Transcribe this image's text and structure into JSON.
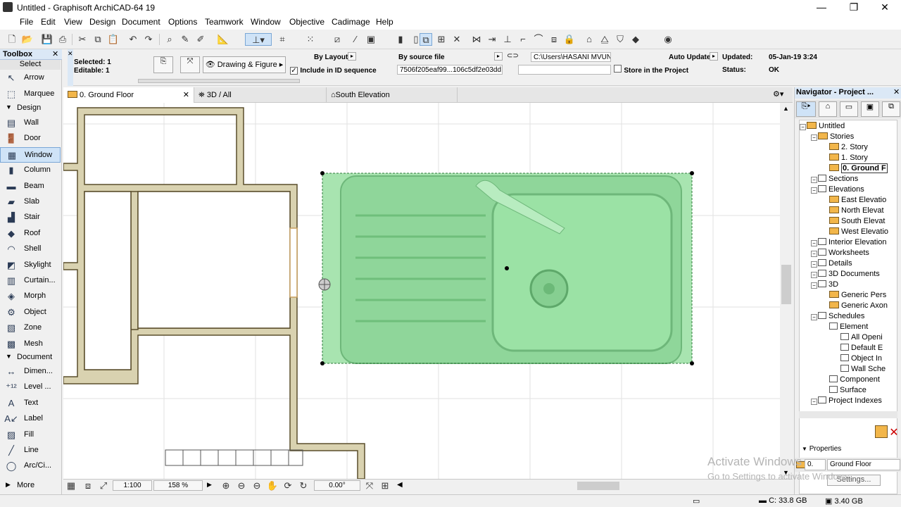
{
  "window": {
    "title": "Untitled - Graphisoft ArchiCAD-64 19",
    "minimize": "—",
    "restore": "❐",
    "close": "✕"
  },
  "menu": [
    "File",
    "Edit",
    "View",
    "Design",
    "Document",
    "Options",
    "Teamwork",
    "Window",
    "Objective",
    "Cadimage",
    "Help"
  ],
  "infobox": {
    "selected": "Selected: 1",
    "editable": "Editable: 1",
    "drawing_figure": "Drawing & Figure",
    "by_layout": "By Layout",
    "include_id": "Include in ID sequence",
    "by_source": "By source file",
    "file_id": "7506f205eaf99...106c5df2e03dd",
    "path": "C:\\Users\\HASANI MVUN",
    "auto_update": "Auto Update",
    "store_project": "Store in the Project",
    "updated_label": "Updated:",
    "updated_value": "05-Jan-19 3:24",
    "status_label": "Status:",
    "status_value": "OK"
  },
  "toolbox": {
    "title": "Toolbox",
    "select": "Select",
    "arrow": "Arrow",
    "marquee": "Marquee",
    "design": "Design",
    "design_tools": [
      "Wall",
      "Door",
      "Window",
      "Column",
      "Beam",
      "Slab",
      "Stair",
      "Roof",
      "Shell",
      "Skylight",
      "Curtain...",
      "Morph",
      "Object",
      "Zone",
      "Mesh"
    ],
    "document": "Document",
    "document_tools": [
      "Dimen...",
      "Level ...",
      "Text",
      "Label",
      "Fill",
      "Line",
      "Arc/Ci..."
    ],
    "more": "More"
  },
  "tabs": [
    "0. Ground Floor",
    "3D / All",
    "South Elevation"
  ],
  "status": {
    "scale": "1:100",
    "zoom": "158 %",
    "angle": "0.00°"
  },
  "navigator": {
    "title": "Navigator - Project ...",
    "tree": [
      {
        "label": "Untitled",
        "level": 0,
        "icon": "folder"
      },
      {
        "label": "Stories",
        "level": 1,
        "icon": "folder"
      },
      {
        "label": "2. Story",
        "level": 2,
        "icon": "folder"
      },
      {
        "label": "1. Story",
        "level": 2,
        "icon": "folder"
      },
      {
        "label": "0. Ground F",
        "level": 2,
        "icon": "folder",
        "selected": true
      },
      {
        "label": "Sections",
        "level": 1,
        "icon": "doc"
      },
      {
        "label": "Elevations",
        "level": 1,
        "icon": "doc"
      },
      {
        "label": "East Elevatio",
        "level": 2,
        "icon": "folder"
      },
      {
        "label": "North Elevat",
        "level": 2,
        "icon": "folder"
      },
      {
        "label": "South Elevat",
        "level": 2,
        "icon": "folder"
      },
      {
        "label": "West Elevatio",
        "level": 2,
        "icon": "folder"
      },
      {
        "label": "Interior Elevation",
        "level": 1,
        "icon": "doc"
      },
      {
        "label": "Worksheets",
        "level": 1,
        "icon": "doc"
      },
      {
        "label": "Details",
        "level": 1,
        "icon": "doc"
      },
      {
        "label": "3D Documents",
        "level": 1,
        "icon": "doc"
      },
      {
        "label": "3D",
        "level": 1,
        "icon": "doc"
      },
      {
        "label": "Generic Pers",
        "level": 2,
        "icon": "folder"
      },
      {
        "label": "Generic Axon",
        "level": 2,
        "icon": "folder"
      },
      {
        "label": "Schedules",
        "level": 1,
        "icon": "doc"
      },
      {
        "label": "Element",
        "level": 2,
        "icon": "doc"
      },
      {
        "label": "All Openi",
        "level": 3,
        "icon": "doc"
      },
      {
        "label": "Default E",
        "level": 3,
        "icon": "doc"
      },
      {
        "label": "Object In",
        "level": 3,
        "icon": "doc"
      },
      {
        "label": "Wall Sche",
        "level": 3,
        "icon": "doc"
      },
      {
        "label": "Component",
        "level": 2,
        "icon": "doc"
      },
      {
        "label": "Surface",
        "level": 2,
        "icon": "doc"
      },
      {
        "label": "Project Indexes",
        "level": 1,
        "icon": "doc"
      }
    ],
    "properties": "Properties",
    "story_id": "0.",
    "story_name": "Ground Floor",
    "settings": "Settings..."
  },
  "watermark": {
    "line1": "Activate Windows",
    "line2": "Go to Settings to activate Windows."
  },
  "disk": {
    "c": "C: 33.8 GB",
    "mem": "3.40 GB"
  },
  "colors": {
    "wall_fill": "#d9d2b0",
    "wall_stroke": "#5a4e2c",
    "sink_green": "#9fe0a8",
    "selection": "#2d7a3a"
  }
}
